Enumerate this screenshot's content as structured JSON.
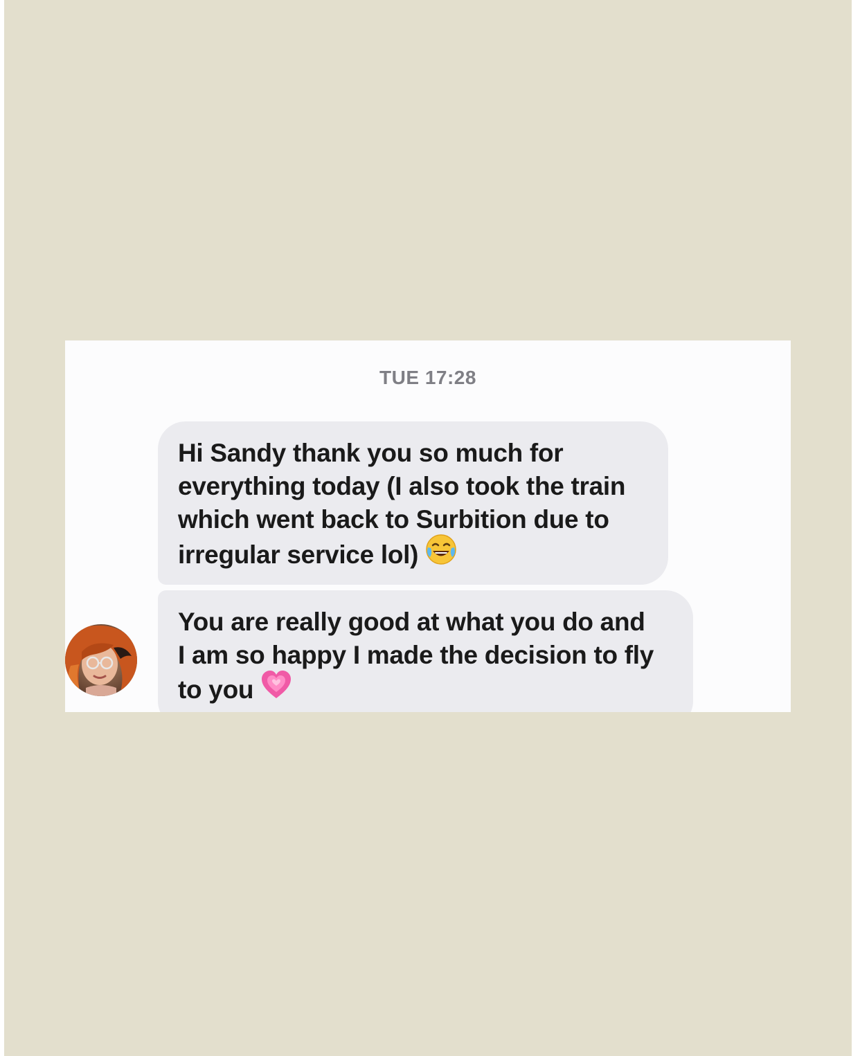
{
  "conversation": {
    "timestamp": "TUE 17:28",
    "messages": [
      {
        "lines": [
          "Hi Sandy thank you so much for",
          "everything today (I also took the train",
          "which went back to Surbition due to",
          "irregular service lol)"
        ],
        "emoji": "face-with-tears-of-joy-icon"
      },
      {
        "lines": [
          "You are really good at what you do and",
          "I am so happy I made the decision to fly",
          "to you"
        ],
        "emoji": "growing-heart-icon"
      }
    ]
  },
  "colors": {
    "backdrop": "#e3dfcd",
    "card": "#fcfcfd",
    "bubble": "#ebebef",
    "timestamp": "#7f7f85",
    "text": "#1a1a1a"
  }
}
